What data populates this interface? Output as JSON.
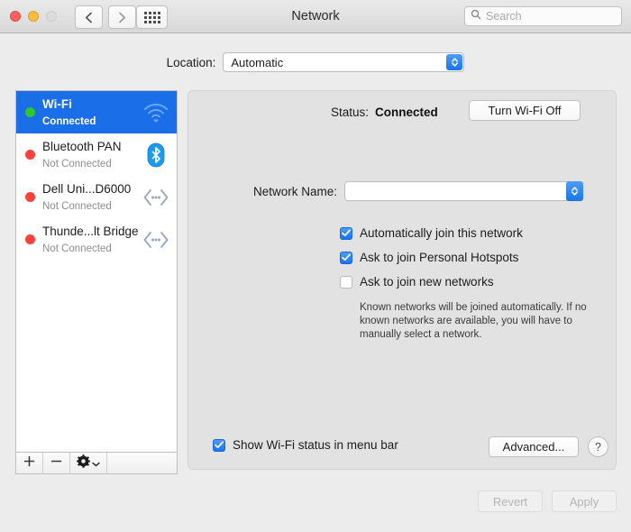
{
  "window": {
    "title": "Network",
    "traffic_lights": [
      "close",
      "minimize",
      "zoom-disabled"
    ],
    "back_icon": "chevron-left-icon",
    "forward_icon": "chevron-right-icon",
    "grid_icon": "show-all-grid-icon",
    "search": {
      "icon": "search-icon",
      "placeholder": "Search",
      "value": ""
    }
  },
  "location": {
    "label": "Location:",
    "value": "Automatic",
    "options": [
      "Automatic"
    ]
  },
  "sidebar": {
    "services": [
      {
        "name": "Wi-Fi",
        "status": "Connected",
        "dot": "green",
        "icon": "wifi-icon",
        "selected": true
      },
      {
        "name": "Bluetooth PAN",
        "status": "Not Connected",
        "dot": "red",
        "icon": "bluetooth-icon",
        "selected": false
      },
      {
        "name": "Dell Uni...D6000",
        "status": "Not Connected",
        "dot": "red",
        "icon": "adapter-icon",
        "selected": false
      },
      {
        "name": "Thunde...lt Bridge",
        "status": "Not Connected",
        "dot": "red",
        "icon": "adapter-icon",
        "selected": false
      }
    ],
    "toolbar": {
      "add_label": "+",
      "remove_label": "−",
      "gear_icon": "gear-icon",
      "gear_chevron_icon": "chevron-down-icon"
    }
  },
  "panel": {
    "status_label": "Status:",
    "status_value": "Connected",
    "turn_wifi_label": "Turn Wi-Fi Off",
    "network_name_label": "Network Name:",
    "network_name_value": "",
    "checkboxes": [
      {
        "label": "Automatically join this network",
        "checked": true
      },
      {
        "label": "Ask to join Personal Hotspots",
        "checked": true
      },
      {
        "label": "Ask to join new networks",
        "checked": false
      }
    ],
    "help_text": "Known networks will be joined automatically. If no known networks are available, you will have to manually select a network.",
    "show_status_label": "Show Wi-Fi status in menu bar",
    "show_status_checked": true,
    "advanced_label": "Advanced...",
    "help_button_label": "?"
  },
  "footer": {
    "revert_label": "Revert",
    "apply_label": "Apply",
    "revert_enabled": false,
    "apply_enabled": false
  },
  "colors": {
    "accent": "#1a6ee8",
    "window_bg": "#ececec",
    "panel_bg": "#e2e2e2",
    "status_green": "#2fc52f",
    "status_red": "#f9423a"
  }
}
